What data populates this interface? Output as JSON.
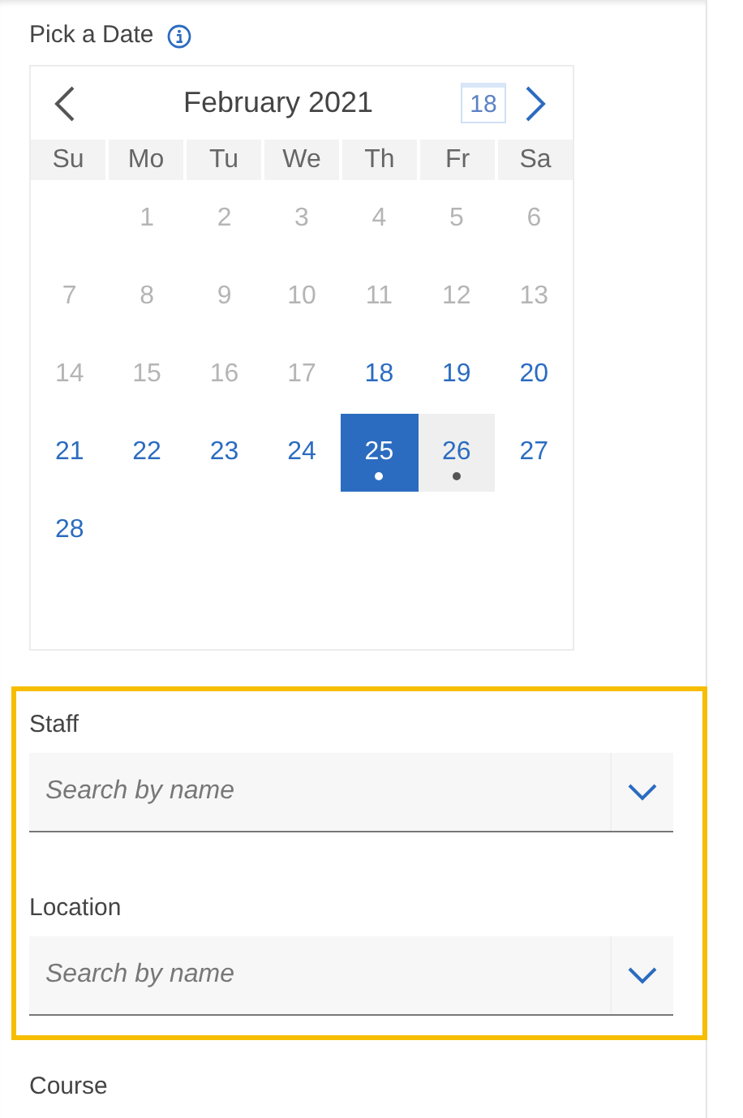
{
  "date_picker": {
    "label": "Pick a Date",
    "month": "February 2021",
    "today_button": "18",
    "weekdays": [
      "Su",
      "Mo",
      "Tu",
      "We",
      "Th",
      "Fr",
      "Sa"
    ],
    "weeks": [
      [
        {
          "label": "1",
          "available": false,
          "selected": false,
          "marked": false,
          "today": false
        },
        {
          "label": "2",
          "available": false,
          "selected": false,
          "marked": false,
          "today": false
        },
        {
          "label": "3",
          "available": false,
          "selected": false,
          "marked": false,
          "today": false
        },
        {
          "label": "4",
          "available": false,
          "selected": false,
          "marked": false,
          "today": false
        },
        {
          "label": "5",
          "available": false,
          "selected": false,
          "marked": false,
          "today": false
        },
        {
          "label": "6",
          "available": false,
          "selected": false,
          "marked": false,
          "today": false
        }
      ],
      [
        {
          "label": "7",
          "available": false,
          "selected": false,
          "marked": false,
          "today": false
        },
        {
          "label": "8",
          "available": false,
          "selected": false,
          "marked": false,
          "today": false
        },
        {
          "label": "9",
          "available": false,
          "selected": false,
          "marked": false,
          "today": false
        },
        {
          "label": "10",
          "available": false,
          "selected": false,
          "marked": false,
          "today": false
        },
        {
          "label": "11",
          "available": false,
          "selected": false,
          "marked": false,
          "today": false
        },
        {
          "label": "12",
          "available": false,
          "selected": false,
          "marked": false,
          "today": false
        },
        {
          "label": "13",
          "available": false,
          "selected": false,
          "marked": false,
          "today": false
        }
      ],
      [
        {
          "label": "14",
          "available": false,
          "selected": false,
          "marked": false,
          "today": false
        },
        {
          "label": "15",
          "available": false,
          "selected": false,
          "marked": false,
          "today": false
        },
        {
          "label": "16",
          "available": false,
          "selected": false,
          "marked": false,
          "today": false
        },
        {
          "label": "17",
          "available": false,
          "selected": false,
          "marked": false,
          "today": false
        },
        {
          "label": "18",
          "available": true,
          "selected": false,
          "marked": false,
          "today": false
        },
        {
          "label": "19",
          "available": true,
          "selected": false,
          "marked": false,
          "today": false
        },
        {
          "label": "20",
          "available": true,
          "selected": false,
          "marked": false,
          "today": false
        }
      ],
      [
        {
          "label": "21",
          "available": true,
          "selected": false,
          "marked": false,
          "today": false
        },
        {
          "label": "22",
          "available": true,
          "selected": false,
          "marked": false,
          "today": false
        },
        {
          "label": "23",
          "available": true,
          "selected": false,
          "marked": false,
          "today": false
        },
        {
          "label": "24",
          "available": true,
          "selected": false,
          "marked": false,
          "today": false
        },
        {
          "label": "25",
          "available": true,
          "selected": true,
          "marked": true,
          "today": false
        },
        {
          "label": "26",
          "available": true,
          "selected": false,
          "marked": true,
          "today": true
        },
        {
          "label": "27",
          "available": true,
          "selected": false,
          "marked": false,
          "today": false
        }
      ],
      [
        {
          "label": "28",
          "available": true,
          "selected": false,
          "marked": false,
          "today": false
        }
      ]
    ]
  },
  "filters": [
    {
      "label": "Staff",
      "placeholder": "Search by name"
    },
    {
      "label": "Location",
      "placeholder": "Search by name"
    }
  ],
  "next_section": {
    "label": "Course"
  }
}
